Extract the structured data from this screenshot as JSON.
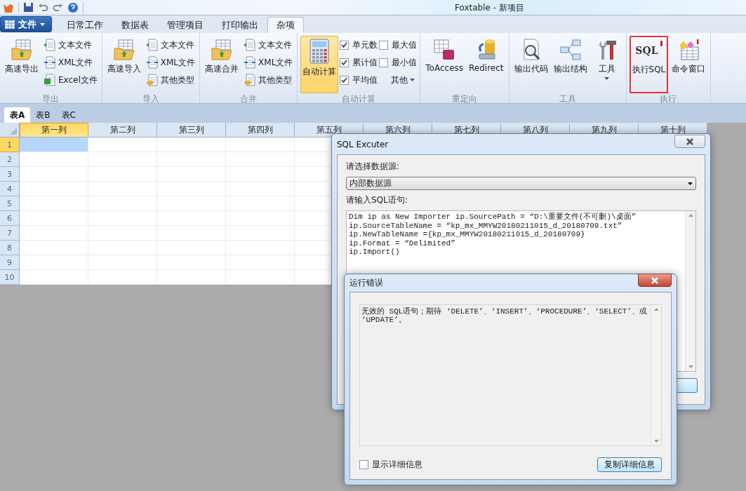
{
  "window": {
    "title": "Foxtable - 新项目"
  },
  "file_button": {
    "label": "文件"
  },
  "tabs": [
    {
      "label": "日常工作",
      "selected": false
    },
    {
      "label": "数据表",
      "selected": false
    },
    {
      "label": "管理项目",
      "selected": false
    },
    {
      "label": "打印输出",
      "selected": false
    },
    {
      "label": "杂项",
      "selected": true
    }
  ],
  "ribbon_groups": [
    {
      "title": "导出",
      "items": [
        {
          "kind": "large",
          "label": "高速导出"
        },
        {
          "kind": "small",
          "label": "文本文件"
        },
        {
          "kind": "small",
          "label": "XML文件"
        },
        {
          "kind": "small",
          "label": "Excel文件"
        }
      ]
    },
    {
      "title": "导入",
      "items": [
        {
          "kind": "large",
          "label": "高速导入"
        },
        {
          "kind": "small",
          "label": "文本文件"
        },
        {
          "kind": "small",
          "label": "XML文件"
        },
        {
          "kind": "small",
          "label": "其他类型"
        }
      ]
    },
    {
      "title": "合并",
      "items": [
        {
          "kind": "large",
          "label": "高速合并"
        },
        {
          "kind": "small",
          "label": "文本文件"
        },
        {
          "kind": "small",
          "label": "XML文件"
        },
        {
          "kind": "small",
          "label": "其他类型"
        }
      ]
    },
    {
      "title": "自动计算",
      "items": [
        {
          "kind": "large",
          "label": "自动计算",
          "on": true
        },
        {
          "kind": "check",
          "label": "单元数",
          "checked": true
        },
        {
          "kind": "check",
          "label": "累计值",
          "checked": true
        },
        {
          "kind": "check",
          "label": "平均值",
          "checked": true
        },
        {
          "kind": "check",
          "label": "最大值",
          "checked": false
        },
        {
          "kind": "check",
          "label": "最小值",
          "checked": false
        },
        {
          "kind": "dropdown",
          "label": "其他"
        }
      ]
    },
    {
      "title": "重定向",
      "items": [
        {
          "kind": "large",
          "label": "ToAccess"
        },
        {
          "kind": "large",
          "label": "Redirect"
        }
      ]
    },
    {
      "title": "工具",
      "items": [
        {
          "kind": "large",
          "label": "输出代码"
        },
        {
          "kind": "large",
          "label": "输出结构"
        },
        {
          "kind": "large_dropdown",
          "label": "工具"
        }
      ]
    },
    {
      "title": "执行",
      "items": [
        {
          "kind": "large",
          "label": "执行SQL",
          "icon_text": "SQL",
          "highlighted": true
        },
        {
          "kind": "large",
          "label": "命令窗口"
        }
      ]
    }
  ],
  "sheet_tabs": [
    {
      "label": "表A",
      "selected": true
    },
    {
      "label": "表B",
      "selected": false
    },
    {
      "label": "表C",
      "selected": false
    }
  ],
  "table": {
    "columns": [
      {
        "label": "第一列",
        "selected": true
      },
      {
        "label": "第二列",
        "selected": false
      },
      {
        "label": "第三列",
        "selected": false
      },
      {
        "label": "第四列",
        "selected": false
      },
      {
        "label": "第五列",
        "selected": false
      },
      {
        "label": "第六列",
        "selected": false
      },
      {
        "label": "第七列",
        "selected": false
      },
      {
        "label": "第八列",
        "selected": false
      },
      {
        "label": "第九列",
        "selected": false
      },
      {
        "label": "第十列",
        "selected": false
      }
    ],
    "rows": [
      {
        "label": "1",
        "selected": true
      },
      {
        "label": "2",
        "selected": false
      },
      {
        "label": "3",
        "selected": false
      },
      {
        "label": "4",
        "selected": false
      },
      {
        "label": "5",
        "selected": false
      },
      {
        "label": "6",
        "selected": false
      },
      {
        "label": "7",
        "selected": false
      },
      {
        "label": "8",
        "selected": false
      },
      {
        "label": "9",
        "selected": false
      },
      {
        "label": "10",
        "selected": false
      }
    ]
  },
  "sql_dialog": {
    "title": "SQL Excuter",
    "source_label": "请选择数据源:",
    "source_value": "内部数据源",
    "sql_label": "请输入SQL语句:",
    "sql_lines": [
      "Dim ip as New Importer ip.SourcePath = “D:\\重要文件(不可删)\\桌面”",
      "ip.SourceTableName = “kp_mx_MMYW20180211015_d_20180709.txt”",
      "ip.NewTableName ={kp_mx_MMYW20180211015_d_20180709}",
      "ip.Format = “Delimited”",
      "ip.Import()"
    ]
  },
  "error_dialog": {
    "title": "运行错误",
    "message": "无效的 SQL语句；期待 ‘DELETE’、‘INSERT’、‘PROCEDURE’、‘SELECT’、或 ‘UPDATE’。",
    "details_checkbox": {
      "label": "显示详细信息",
      "checked": false
    },
    "copy_button": "复制详细信息"
  }
}
